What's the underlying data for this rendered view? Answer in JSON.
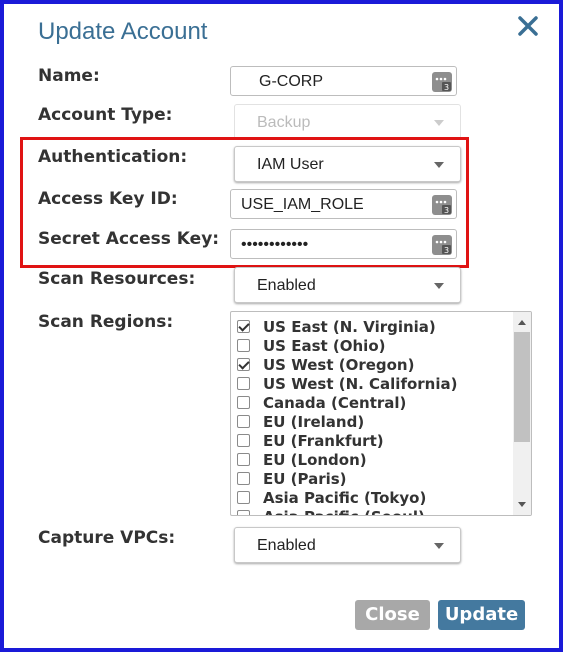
{
  "dialog": {
    "title": "Update Account",
    "close_icon": "close-icon"
  },
  "fields": {
    "name": {
      "label": "Name:",
      "value": "G-CORP"
    },
    "account_type": {
      "label": "Account Type:",
      "value": "Backup",
      "disabled": true
    },
    "authentication": {
      "label": "Authentication:",
      "value": "IAM User"
    },
    "access_key_id": {
      "label": "Access Key ID:",
      "value": "USE_IAM_ROLE"
    },
    "secret_access_key": {
      "label": "Secret Access Key:",
      "value": "••••••••••••"
    },
    "scan_resources": {
      "label": "Scan Resources:",
      "value": "Enabled"
    },
    "scan_regions": {
      "label": "Scan Regions:",
      "items": [
        {
          "label": "US East (N. Virginia)",
          "checked": true
        },
        {
          "label": "US East (Ohio)",
          "checked": false
        },
        {
          "label": "US West (Oregon)",
          "checked": true
        },
        {
          "label": "US West (N. California)",
          "checked": false
        },
        {
          "label": "Canada (Central)",
          "checked": false
        },
        {
          "label": "EU (Ireland)",
          "checked": false
        },
        {
          "label": "EU (Frankfurt)",
          "checked": false
        },
        {
          "label": "EU (London)",
          "checked": false
        },
        {
          "label": "EU (Paris)",
          "checked": false
        },
        {
          "label": "Asia Pacific (Tokyo)",
          "checked": false
        },
        {
          "label": "Asia Pacific (Seoul)",
          "checked": false
        }
      ]
    },
    "capture_vpcs": {
      "label": "Capture VPCs:",
      "value": "Enabled"
    }
  },
  "buttons": {
    "close": "Close",
    "update": "Update"
  },
  "colors": {
    "frame_border": "#1a1ad8",
    "highlight_border": "#e01313",
    "title": "#3a6f94",
    "update_button": "#44799f",
    "close_button": "#a8a8a8"
  },
  "icons": {
    "password_manager": "keypass-icon"
  }
}
